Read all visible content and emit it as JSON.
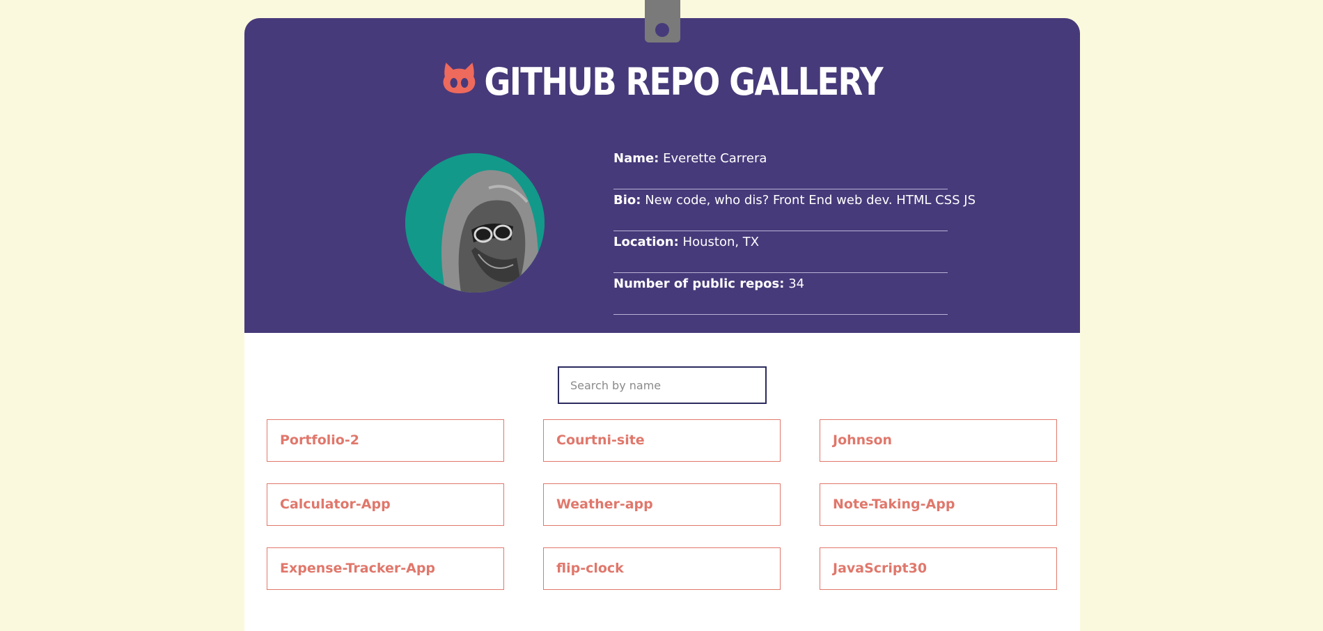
{
  "header": {
    "title": "GITHUB REPO GALLERY",
    "logo_icon": "github-octocat-icon"
  },
  "profile": {
    "name_label": "Name:",
    "name": "Everette Carrera",
    "bio_label": "Bio:",
    "bio": "New code, who dis? Front End web dev. HTML CSS JS",
    "location_label": "Location:",
    "location": "Houston, TX",
    "repos_label": "Number of public repos:",
    "repos": "34"
  },
  "search": {
    "placeholder": "Search by name",
    "value": ""
  },
  "repos": [
    {
      "name": "Portfolio-2"
    },
    {
      "name": "Courtni-site"
    },
    {
      "name": "Johnson"
    },
    {
      "name": "Calculator-App"
    },
    {
      "name": "Weather-app"
    },
    {
      "name": "Note-Taking-App"
    },
    {
      "name": "Expense-Tracker-App"
    },
    {
      "name": "flip-clock"
    },
    {
      "name": "JavaScript30"
    }
  ],
  "colors": {
    "background": "#fbf9dd",
    "header": "#473a7a",
    "accent": "#e0776b",
    "tab": "#7a7a7a"
  }
}
